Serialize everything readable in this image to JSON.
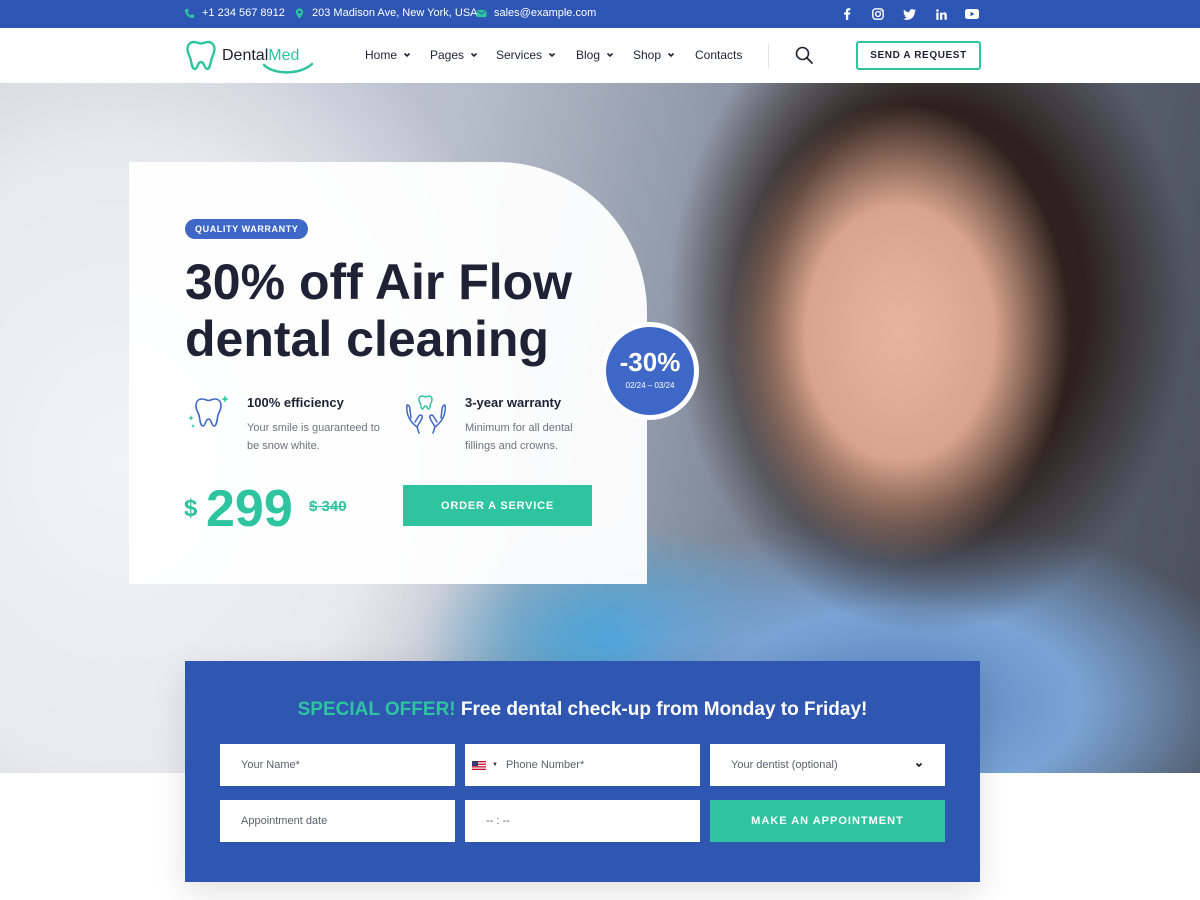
{
  "topbar": {
    "phone": "+1 234 567 8912",
    "address": "203 Madison Ave, New York, USA",
    "email": "sales@example.com",
    "social": [
      {
        "name": "facebook-icon",
        "glyph": "f"
      },
      {
        "name": "instagram-icon",
        "glyph": ""
      },
      {
        "name": "twitter-icon",
        "glyph": ""
      },
      {
        "name": "linkedin-icon",
        "glyph": "in"
      },
      {
        "name": "youtube-icon",
        "glyph": ""
      }
    ]
  },
  "header": {
    "logo": {
      "part1": "Dental",
      "part2": "Med"
    },
    "nav": [
      "Home",
      "Pages",
      "Services",
      "Blog",
      "Shop",
      "Contacts"
    ],
    "cta": "SEND A REQUEST"
  },
  "hero": {
    "badge": "QUALITY WARRANTY",
    "title": "30% off Air Flow dental cleaning",
    "features": [
      {
        "title": "100% efficiency",
        "text": "Your smile is guaranteed to be snow white."
      },
      {
        "title": "3-year warranty",
        "text": "Minimum for all dental fillings and crowns."
      }
    ],
    "price": {
      "currency": "$",
      "value": "299",
      "old": "$ 340"
    },
    "order_button": "ORDER A SERVICE",
    "discount": {
      "percent": "-30%",
      "dates": "02/24 – 03/24"
    }
  },
  "offer": {
    "highlight": "SPECIAL OFFER!",
    "title": "Free dental check-up from Monday to Friday!",
    "fields": {
      "name": "Your Name*",
      "phone": "Phone Number*",
      "dentist": "Your dentist (optional)",
      "date": "Appointment date",
      "time": "-- : --"
    },
    "button": "MAKE AN APPOINTMENT"
  },
  "colors": {
    "brand_blue": "#2d55b4",
    "accent_green": "#2ec4a0",
    "dark_text": "#1f2235"
  }
}
